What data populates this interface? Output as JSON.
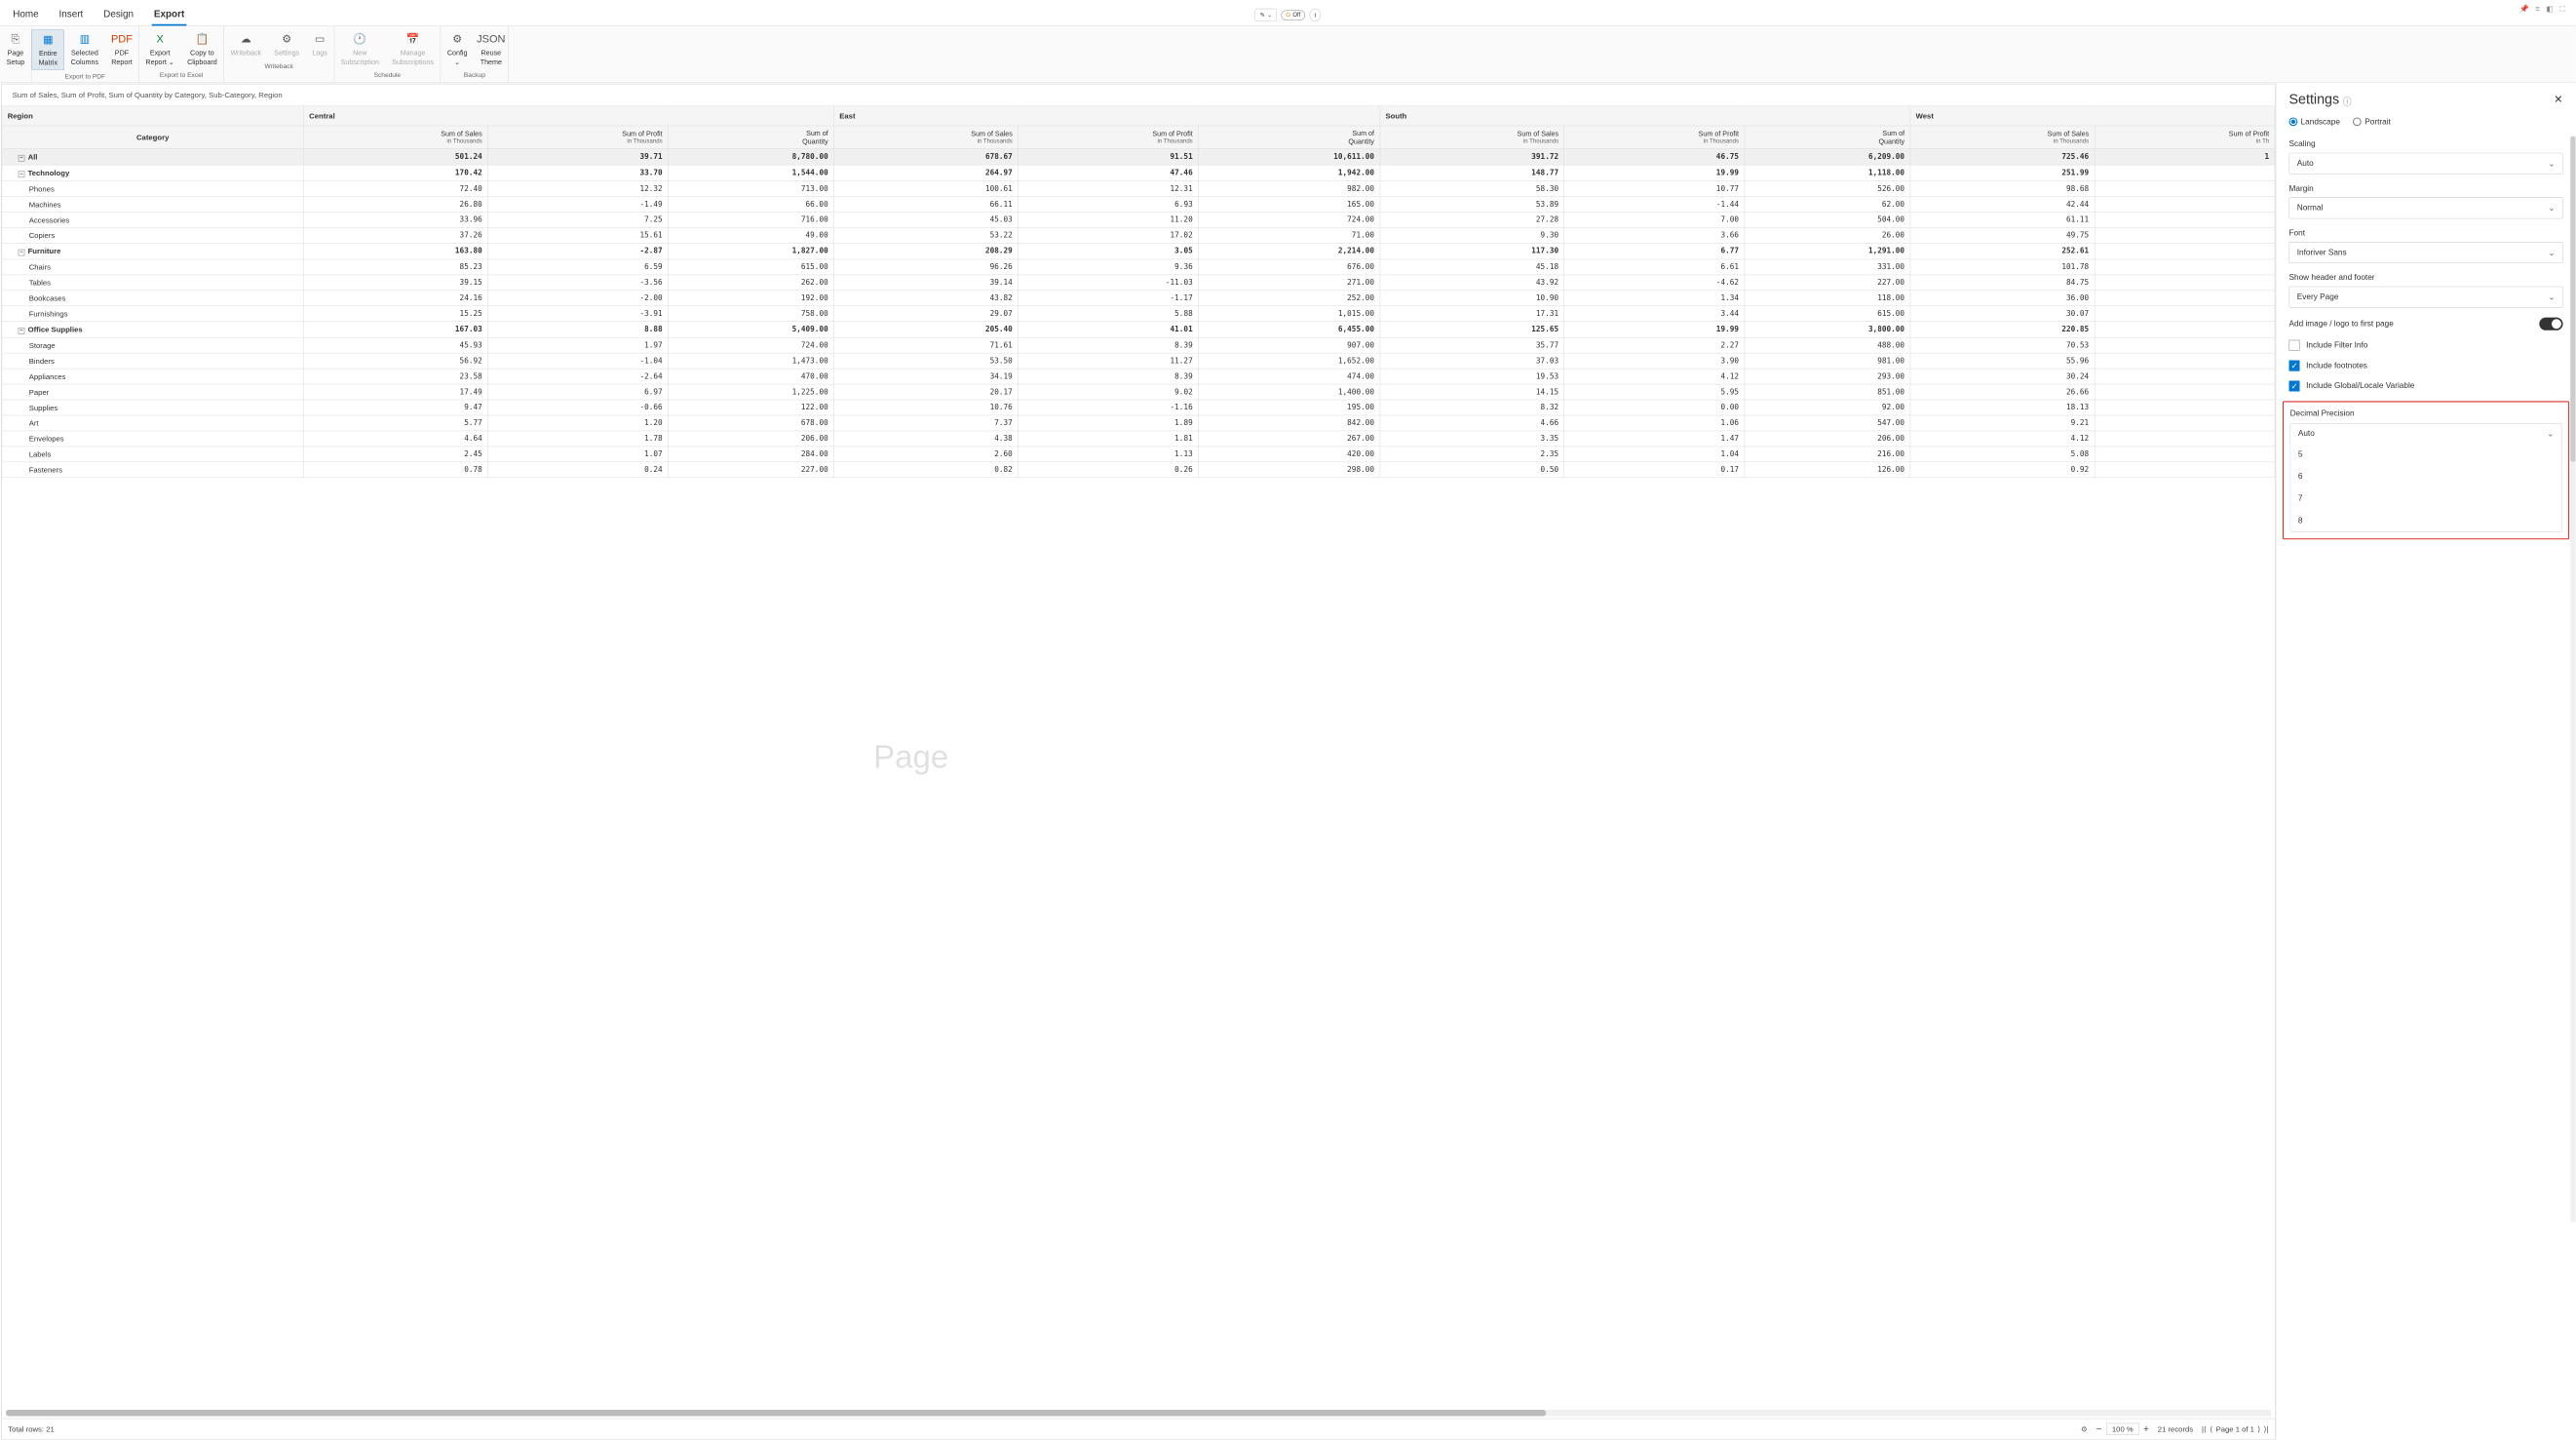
{
  "top_tabs": [
    "Home",
    "Insert",
    "Design",
    "Export"
  ],
  "top_tab_active": 3,
  "toggle_label": "Off",
  "top_right_icons": [
    "pin-icon",
    "filter-icon",
    "window-icon",
    "expand-icon"
  ],
  "ribbon": {
    "groups": [
      {
        "label": "",
        "buttons": [
          {
            "icon": "⎘",
            "label": "Page\nSetup"
          }
        ]
      },
      {
        "label": "Export to PDF",
        "buttons": [
          {
            "icon": "▦",
            "label": "Entire\nMatrix",
            "active": true,
            "color": "#0078d4"
          },
          {
            "icon": "▥",
            "label": "Selected\nColumns",
            "color": "#0078d4"
          },
          {
            "icon": "PDF",
            "label": "PDF\nReport",
            "color": "#d83b01"
          }
        ]
      },
      {
        "label": "Export to Excel",
        "buttons": [
          {
            "icon": "X",
            "label": "Export\nReport ⌄",
            "color": "#107c41"
          },
          {
            "icon": "📋",
            "label": "Copy to\nClipboard"
          }
        ]
      },
      {
        "label": "Writeback",
        "buttons": [
          {
            "icon": "☁",
            "label": "Writeback",
            "disabled": true
          },
          {
            "icon": "⚙",
            "label": "Settings",
            "disabled": true
          },
          {
            "icon": "▭",
            "label": "Logs",
            "disabled": true
          }
        ]
      },
      {
        "label": "Schedule",
        "buttons": [
          {
            "icon": "🕐",
            "label": "New\nSubscription",
            "disabled": true
          },
          {
            "icon": "📅",
            "label": "Manage\nSubscriptions",
            "disabled": true
          }
        ]
      },
      {
        "label": "Backup",
        "buttons": [
          {
            "icon": "⚙",
            "label": "Config\n⌄"
          },
          {
            "icon": "JSON",
            "label": "Reuse\nTheme"
          }
        ]
      }
    ]
  },
  "content_title": "Sum of Sales, Sum of Profit, Sum of Quantity by Category, Sub-Category, Region",
  "watermark": "Page",
  "table": {
    "region_label": "Region",
    "category_label": "Category",
    "regions": [
      "Central",
      "East",
      "South",
      "West"
    ],
    "measures": [
      {
        "name": "Sum of Sales",
        "sub": "in Thousands"
      },
      {
        "name": "Sum of Profit",
        "sub": "in Thousands"
      },
      {
        "name": "Sum of\nQuantity",
        "sub": ""
      }
    ],
    "last_col_partial": {
      "name": "Sum of Profit",
      "sub": "in Th"
    },
    "rows": [
      {
        "type": "all",
        "label": "All",
        "vals": [
          "501.24",
          "39.71",
          "8,780.00",
          "678.67",
          "91.51",
          "10,611.00",
          "391.72",
          "46.75",
          "6,209.00",
          "725.46",
          "1"
        ]
      },
      {
        "type": "group",
        "label": "Technology",
        "vals": [
          "170.42",
          "33.70",
          "1,544.00",
          "264.97",
          "47.46",
          "1,942.00",
          "148.77",
          "19.99",
          "1,118.00",
          "251.99",
          ""
        ]
      },
      {
        "type": "item",
        "label": "Phones",
        "vals": [
          "72.40",
          "12.32",
          "713.00",
          "100.61",
          "12.31",
          "982.00",
          "58.30",
          "10.77",
          "526.00",
          "98.68",
          ""
        ]
      },
      {
        "type": "item",
        "label": "Machines",
        "vals": [
          "26.80",
          "-1.49",
          "66.00",
          "66.11",
          "6.93",
          "165.00",
          "53.89",
          "-1.44",
          "62.00",
          "42.44",
          ""
        ]
      },
      {
        "type": "item",
        "label": "Accessories",
        "vals": [
          "33.96",
          "7.25",
          "716.00",
          "45.03",
          "11.20",
          "724.00",
          "27.28",
          "7.00",
          "504.00",
          "61.11",
          ""
        ]
      },
      {
        "type": "item",
        "label": "Copiers",
        "vals": [
          "37.26",
          "15.61",
          "49.00",
          "53.22",
          "17.02",
          "71.00",
          "9.30",
          "3.66",
          "26.00",
          "49.75",
          ""
        ]
      },
      {
        "type": "group",
        "label": "Furniture",
        "vals": [
          "163.80",
          "-2.87",
          "1,827.00",
          "208.29",
          "3.05",
          "2,214.00",
          "117.30",
          "6.77",
          "1,291.00",
          "252.61",
          ""
        ]
      },
      {
        "type": "item",
        "label": "Chairs",
        "vals": [
          "85.23",
          "6.59",
          "615.00",
          "96.26",
          "9.36",
          "676.00",
          "45.18",
          "6.61",
          "331.00",
          "101.78",
          ""
        ]
      },
      {
        "type": "item",
        "label": "Tables",
        "vals": [
          "39.15",
          "-3.56",
          "262.00",
          "39.14",
          "-11.03",
          "271.00",
          "43.92",
          "-4.62",
          "227.00",
          "84.75",
          ""
        ]
      },
      {
        "type": "item",
        "label": "Bookcases",
        "vals": [
          "24.16",
          "-2.00",
          "192.00",
          "43.82",
          "-1.17",
          "252.00",
          "10.90",
          "1.34",
          "118.00",
          "36.00",
          ""
        ]
      },
      {
        "type": "item",
        "label": "Furnishings",
        "vals": [
          "15.25",
          "-3.91",
          "758.00",
          "29.07",
          "5.88",
          "1,015.00",
          "17.31",
          "3.44",
          "615.00",
          "30.07",
          ""
        ]
      },
      {
        "type": "group",
        "label": "Office Supplies",
        "vals": [
          "167.03",
          "8.88",
          "5,409.00",
          "205.40",
          "41.01",
          "6,455.00",
          "125.65",
          "19.99",
          "3,800.00",
          "220.85",
          ""
        ]
      },
      {
        "type": "item",
        "label": "Storage",
        "vals": [
          "45.93",
          "1.97",
          "724.00",
          "71.61",
          "8.39",
          "907.00",
          "35.77",
          "2.27",
          "488.00",
          "70.53",
          ""
        ]
      },
      {
        "type": "item",
        "label": "Binders",
        "vals": [
          "56.92",
          "-1.04",
          "1,473.00",
          "53.50",
          "11.27",
          "1,652.00",
          "37.03",
          "3.90",
          "981.00",
          "55.96",
          ""
        ]
      },
      {
        "type": "item",
        "label": "Appliances",
        "vals": [
          "23.58",
          "-2.64",
          "470.00",
          "34.19",
          "8.39",
          "474.00",
          "19.53",
          "4.12",
          "293.00",
          "30.24",
          ""
        ]
      },
      {
        "type": "item",
        "label": "Paper",
        "vals": [
          "17.49",
          "6.97",
          "1,225.00",
          "20.17",
          "9.02",
          "1,400.00",
          "14.15",
          "5.95",
          "851.00",
          "26.66",
          ""
        ]
      },
      {
        "type": "item",
        "label": "Supplies",
        "vals": [
          "9.47",
          "-0.66",
          "122.00",
          "10.76",
          "-1.16",
          "195.00",
          "8.32",
          "0.00",
          "92.00",
          "18.13",
          ""
        ]
      },
      {
        "type": "item",
        "label": "Art",
        "vals": [
          "5.77",
          "1.20",
          "678.00",
          "7.37",
          "1.89",
          "842.00",
          "4.66",
          "1.06",
          "547.00",
          "9.21",
          ""
        ]
      },
      {
        "type": "item",
        "label": "Envelopes",
        "vals": [
          "4.64",
          "1.78",
          "206.00",
          "4.38",
          "1.81",
          "267.00",
          "3.35",
          "1.47",
          "206.00",
          "4.12",
          ""
        ]
      },
      {
        "type": "item",
        "label": "Labels",
        "vals": [
          "2.45",
          "1.07",
          "284.00",
          "2.60",
          "1.13",
          "420.00",
          "2.35",
          "1.04",
          "216.00",
          "5.08",
          ""
        ]
      },
      {
        "type": "item",
        "label": "Fasteners",
        "vals": [
          "0.78",
          "0.24",
          "227.00",
          "0.82",
          "0.26",
          "298.00",
          "0.50",
          "0.17",
          "126.00",
          "0.92",
          ""
        ]
      }
    ]
  },
  "status": {
    "total_rows": "Total rows: 21",
    "zoom": "100 %",
    "records": "21 records",
    "page": "Page 1 of 1"
  },
  "settings": {
    "title": "Settings",
    "orientation": {
      "landscape": "Landscape",
      "portrait": "Portrait",
      "selected": "landscape"
    },
    "scaling": {
      "label": "Scaling",
      "value": "Auto"
    },
    "margin": {
      "label": "Margin",
      "value": "Normal"
    },
    "font": {
      "label": "Font",
      "value": "Inforiver Sans"
    },
    "header_footer": {
      "label": "Show header and footer",
      "value": "Every Page"
    },
    "add_image": {
      "label": "Add image / logo to first page",
      "on": true
    },
    "include_filter": {
      "label": "Include Filter Info",
      "checked": false
    },
    "include_footnotes": {
      "label": "Include footnotes",
      "checked": true
    },
    "include_global": {
      "label": "Include Global/Locale Variable",
      "checked": true
    },
    "decimal": {
      "label": "Decimal Precision",
      "value": "Auto",
      "options": [
        "5",
        "6",
        "7",
        "8"
      ]
    }
  }
}
